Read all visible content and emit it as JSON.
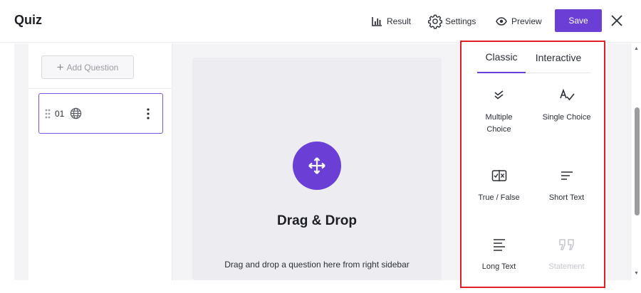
{
  "header": {
    "title": "Quiz",
    "result_label": "Result",
    "settings_label": "Settings",
    "preview_label": "Preview",
    "save_label": "Save"
  },
  "left_panel": {
    "add_question_label": "Add Question",
    "questions": [
      {
        "number": "01",
        "icon": "globe-icon"
      }
    ]
  },
  "center": {
    "icon": "move-arrows-icon",
    "title": "Drag & Drop",
    "subtitle": "Drag and drop a question here from right sidebar"
  },
  "sidebar": {
    "tabs": [
      {
        "label": "Classic",
        "active": true
      },
      {
        "label": "Interactive",
        "active": false
      }
    ],
    "types": [
      {
        "label_line1": "Multiple",
        "label_line2": "Choice",
        "icon": "double-check-icon",
        "enabled": true
      },
      {
        "label_line1": "Single Choice",
        "icon": "single-check-icon",
        "enabled": true
      },
      {
        "label_line1": "True / False",
        "icon": "true-false-icon",
        "enabled": true
      },
      {
        "label_line1": "Short Text",
        "icon": "short-text-icon",
        "enabled": true
      },
      {
        "label_line1": "Long Text",
        "icon": "long-text-icon",
        "enabled": true
      },
      {
        "label_line1": "Statement",
        "icon": "quote-icon",
        "enabled": false
      }
    ]
  },
  "colors": {
    "accent": "#6b3fd6",
    "highlight_border": "#e01e26"
  }
}
